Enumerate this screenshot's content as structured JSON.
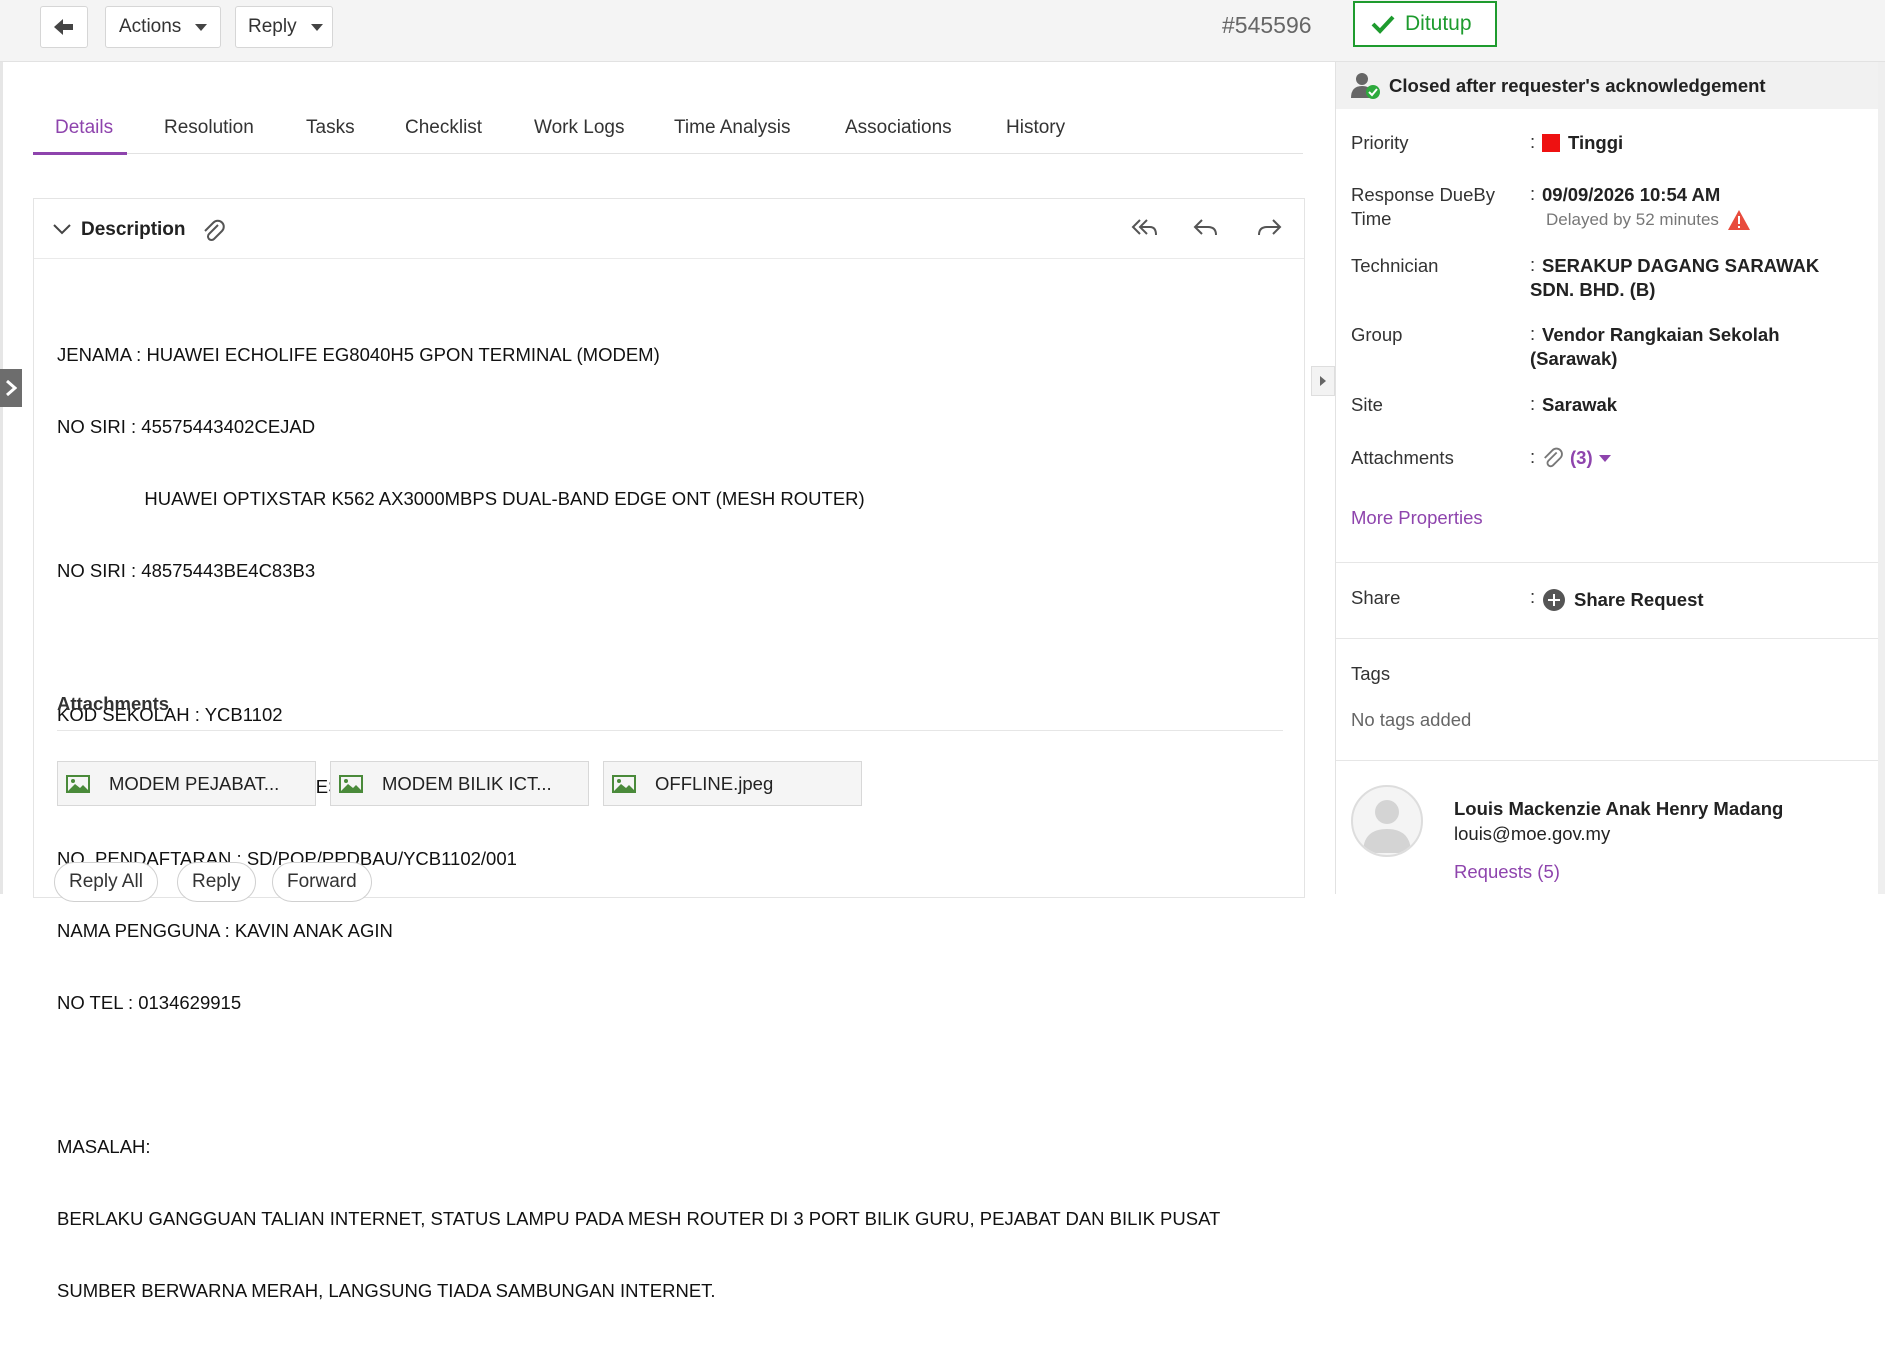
{
  "toolbar": {
    "actions_label": "Actions",
    "reply_label": "Reply",
    "ticket_id": "#545596",
    "status": "Ditutup",
    "status_color": "#1e9b2e"
  },
  "tabs": [
    "Details",
    "Resolution",
    "Tasks",
    "Checklist",
    "Work Logs",
    "Time Analysis",
    "Associations",
    "History"
  ],
  "active_tab": "Details",
  "description": {
    "title": "Description",
    "lines": [
      "JENAMA : HUAWEI ECHOLIFE EG8040H5 GPON TERMINAL (MODEM)",
      "NO SIRI : 45575443402CEJAD",
      "                 HUAWEI OPTIXSTAR K562 AX3000MBPS DUAL-BAND EDGE ONT (MESH ROUTER)",
      "NO SIRI : 48575443BE4C83B3",
      "",
      "KOD SEKOLAH : YCB1102",
      "NAMA SEKOLAH : SK ST. TERESA",
      "NO. PENDAFTARAN : SD/POP/PPDBAU/YCB1102/001",
      "NAMA PENGGUNA : KAVIN ANAK AGIN",
      "NO TEL : 0134629915",
      "",
      "MASALAH:",
      "BERLAKU GANGGUAN TALIAN INTERNET, STATUS LAMPU PADA MESH ROUTER DI 3 PORT BILIK GURU, PEJABAT DAN BILIK PUSAT",
      "SUMBER BERWARNA MERAH, LANGSUNG TIADA SAMBUNGAN INTERNET."
    ],
    "attachments_title": "Attachments",
    "attachments": [
      "MODEM PEJABAT...",
      "MODEM BILIK ICT...",
      "OFFLINE.jpeg"
    ],
    "reply_buttons": [
      "Reply All",
      "Reply",
      "Forward"
    ]
  },
  "panel": {
    "closed_status": "Closed after requester's acknowledgement",
    "priority_label": "Priority",
    "priority_value": "Tinggi",
    "priority_color": "#ee1111",
    "response_label_1": "Response DueBy",
    "response_label_2": "Time",
    "response_value": "09/09/2026 10:54 AM",
    "response_delay": "Delayed by 52 minutes",
    "technician_label": "Technician",
    "technician_value": "SERAKUP DAGANG SARAWAK SDN. BHD. (B)",
    "group_label": "Group",
    "group_value": "Vendor Rangkaian Sekolah (Sarawak)",
    "site_label": "Site",
    "site_value": "Sarawak",
    "attachments_label": "Attachments",
    "attachments_count": "(3)",
    "more_properties": "More Properties",
    "share_label": "Share",
    "share_action": "Share Request",
    "tags_label": "Tags",
    "tags_empty": "No tags added",
    "requester_name": "Louis Mackenzie Anak Henry Madang",
    "requester_email": "louis@moe.gov.my",
    "requester_requests": "Requests (5)",
    "accent_color": "#8e44ad"
  }
}
